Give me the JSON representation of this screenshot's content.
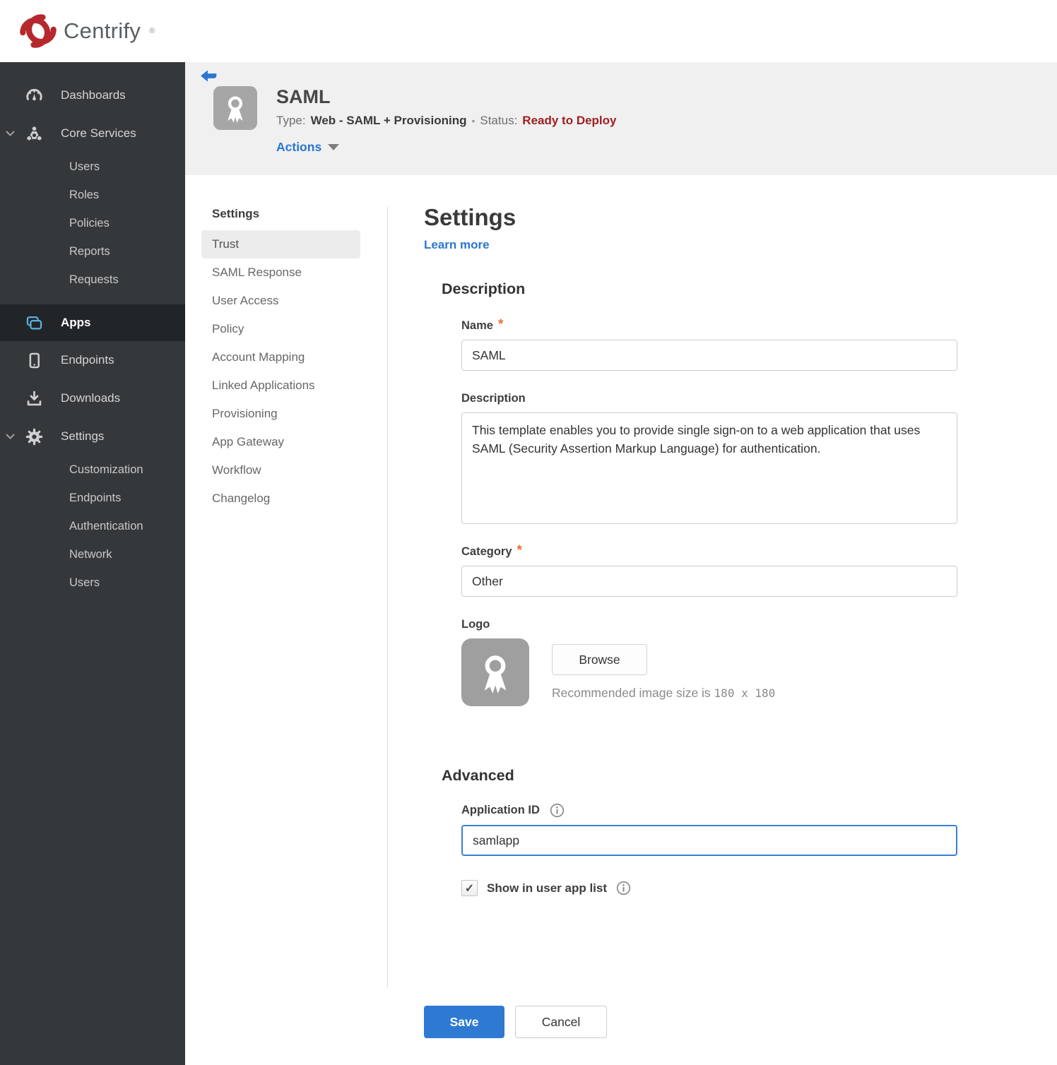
{
  "brand": {
    "name": "Centrify",
    "mark": "®"
  },
  "sidebar": {
    "dashboards": "Dashboards",
    "core_services": "Core Services",
    "core_children": [
      "Users",
      "Roles",
      "Policies",
      "Reports",
      "Requests"
    ],
    "apps": "Apps",
    "endpoints": "Endpoints",
    "downloads": "Downloads",
    "settings": "Settings",
    "settings_children": [
      "Customization",
      "Endpoints",
      "Authentication",
      "Network",
      "Users"
    ]
  },
  "header": {
    "title": "SAML",
    "type_label": "Type:",
    "type_value": "Web - SAML + Provisioning",
    "separator": "•",
    "status_label": "Status:",
    "status_value": "Ready to Deploy",
    "actions_label": "Actions"
  },
  "subnav": {
    "heading": "Settings",
    "selected": "Trust",
    "items": [
      "Trust",
      "SAML Response",
      "User Access",
      "Policy",
      "Account Mapping",
      "Linked Applications",
      "Provisioning",
      "App Gateway",
      "Workflow",
      "Changelog"
    ]
  },
  "main": {
    "heading": "Settings",
    "learn_more": "Learn more",
    "required_marker": "*",
    "description": {
      "heading": "Description",
      "name_label": "Name",
      "name_value": "SAML",
      "description_label": "Description",
      "description_value": "This template enables you to provide single sign-on to a web application that uses SAML (Security Assertion Markup Language) for authentication.",
      "category_label": "Category",
      "category_value": "Other",
      "logo_label": "Logo",
      "browse_label": "Browse",
      "hint_prefix": "Recommended image size is ",
      "hint_dims": "180 x 180"
    },
    "advanced": {
      "heading": "Advanced",
      "app_id_label": "Application ID",
      "app_id_value": "samlapp",
      "show_label": "Show in user app list",
      "checkbox_glyph": "✓"
    },
    "save_label": "Save",
    "cancel_label": "Cancel"
  },
  "colors": {
    "accent_blue": "#2a76d2",
    "save_blue": "#2e7ad3",
    "status_red": "#9f1d1d",
    "sidebar_bg": "#35383a",
    "apps_icon_blue": "#55b1e3",
    "header_bg": "#f0f0f1"
  }
}
